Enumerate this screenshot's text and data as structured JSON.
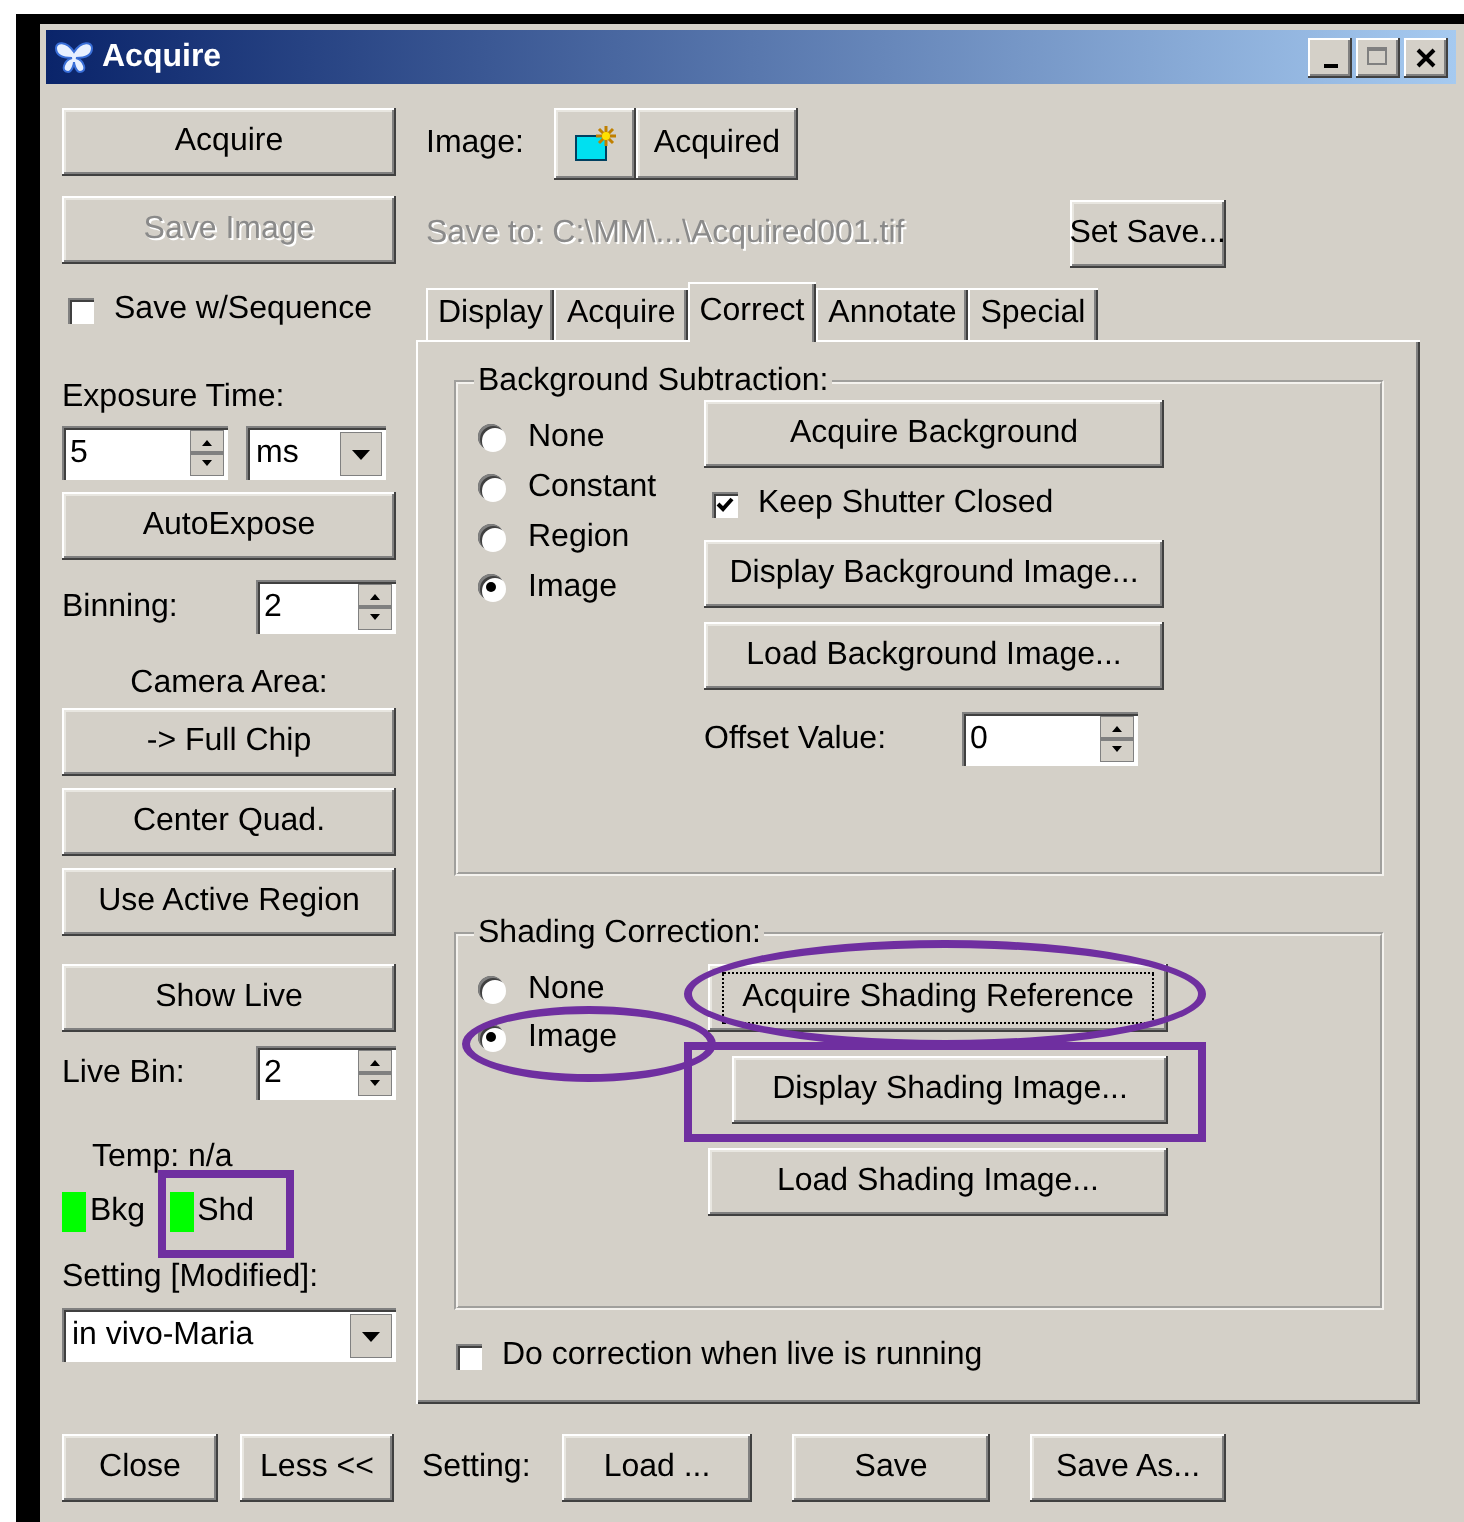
{
  "window": {
    "title": "Acquire"
  },
  "left": {
    "acquire": {
      "label": "Acquire",
      "disabled": false
    },
    "save_image": {
      "label": "Save Image",
      "disabled": true
    },
    "save_with_sequence": {
      "label": "Save w/Sequence",
      "checked": false
    },
    "exposure": {
      "label": "Exposure Time:",
      "value": "5",
      "unit": "ms"
    },
    "autoexpose": {
      "label": "AutoExpose"
    },
    "binning": {
      "label": "Binning:",
      "value": "2"
    },
    "camera_area": {
      "label": "Camera Area:",
      "buttons": [
        "-> Full Chip",
        "Center Quad.",
        "Use Active Region"
      ]
    },
    "show_live": {
      "label": "Show Live"
    },
    "live_bin": {
      "label": "Live Bin:",
      "value": "2"
    },
    "temp": "Temp: n/a",
    "indicators": [
      {
        "label": "Bkg",
        "color": "#00ff00"
      },
      {
        "label": "Shd",
        "color": "#00ff00",
        "boxed": true
      }
    ],
    "setting": {
      "label": "Setting [Modified]:",
      "value": "in vivo-Maria"
    }
  },
  "image_row": {
    "label": "Image:",
    "button": "Acquired"
  },
  "save_row": {
    "text": "Save to: C:\\MM\\...\\Acquired001.tif",
    "button": "Set Save..."
  },
  "tabs": [
    {
      "label": "Display",
      "selected": false
    },
    {
      "label": "Acquire",
      "selected": false
    },
    {
      "label": "Correct",
      "selected": true
    },
    {
      "label": "Annotate",
      "selected": false
    },
    {
      "label": "Special",
      "selected": false
    }
  ],
  "background_subtraction": {
    "title": "Background Subtraction:",
    "options": [
      {
        "label": "None",
        "selected": false
      },
      {
        "label": "Constant",
        "selected": false
      },
      {
        "label": "Region",
        "selected": false
      },
      {
        "label": "Image",
        "selected": true
      }
    ],
    "acquire_button": "Acquire Background",
    "keep_shutter_closed": {
      "label": "Keep Shutter Closed",
      "checked": true
    },
    "buttons": [
      "Display Background Image...",
      "Load Background Image..."
    ],
    "offset": {
      "label": "Offset Value:",
      "value": "0"
    }
  },
  "shading_correction": {
    "title": "Shading Correction:",
    "options": [
      {
        "label": "None",
        "selected": false
      },
      {
        "label": "Image",
        "selected": true,
        "circled": true
      }
    ],
    "buttons": [
      {
        "label": "Acquire Shading Reference",
        "focused": true,
        "circled": true
      },
      {
        "label": "Display Shading Image...",
        "focused": false,
        "boxed": true
      },
      {
        "label": "Load Shading Image...",
        "focused": false
      }
    ]
  },
  "do_correction": {
    "label": "Do correction when live is running",
    "checked": false
  },
  "bottom": {
    "close": "Close",
    "less": "Less <<",
    "setting_label": "Setting:",
    "buttons": [
      "Load ...",
      "Save",
      "Save As..."
    ]
  }
}
